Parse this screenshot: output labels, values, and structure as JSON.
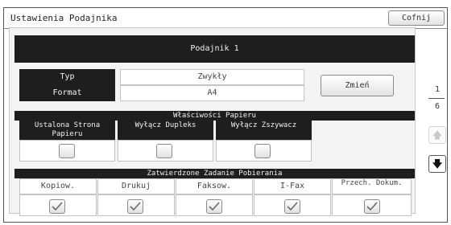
{
  "window": {
    "title": "Ustawienia Podajnika",
    "cancel_label": "Cofnij"
  },
  "tray": {
    "header": "Podajnik 1"
  },
  "settings": [
    {
      "label": "Typ",
      "value": "Zwykły"
    },
    {
      "label": "Format",
      "value": "A4"
    }
  ],
  "change_label": "Zmień",
  "properties": {
    "title": "Właściwości Papieru",
    "items": [
      {
        "label": "Ustalona Strona Papieru",
        "checked": false
      },
      {
        "label": "Wyłącz Dupleks",
        "checked": false
      },
      {
        "label": "Wyłącz Zszywacz",
        "checked": false
      }
    ]
  },
  "jobs": {
    "title": "Zatwierdzone Zadanie Pobierania",
    "items": [
      {
        "label": "Kopiow.",
        "checked": true
      },
      {
        "label": "Drukuj",
        "checked": true
      },
      {
        "label": "Faksow.",
        "checked": true
      },
      {
        "label": "I-Fax",
        "checked": true
      },
      {
        "label": "Przech. Dokum.",
        "checked": true
      }
    ]
  },
  "pager": {
    "current": "1",
    "total": "6"
  },
  "icons": {
    "up": "arrow-up-icon",
    "down": "arrow-down-icon",
    "check": "checkmark-icon"
  }
}
